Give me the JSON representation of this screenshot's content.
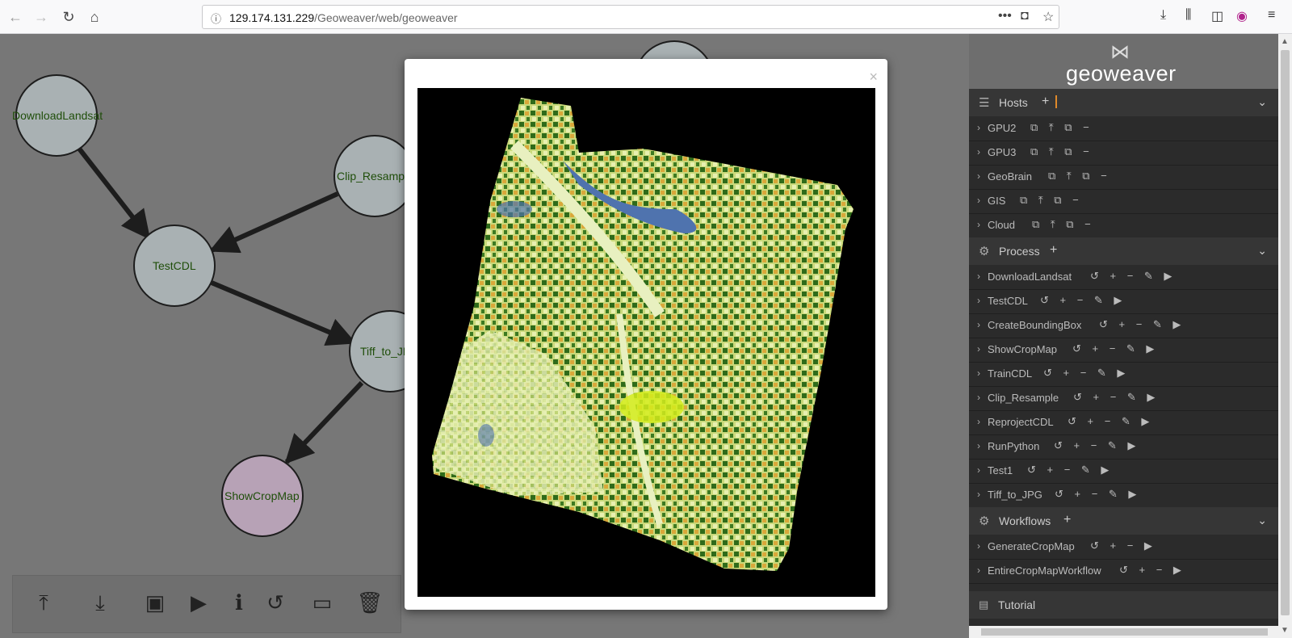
{
  "browser": {
    "url_domain": "129.174.131.229",
    "url_path": "/Geoweaver/web/geoweaver",
    "icons": {
      "back": "back-arrow-icon",
      "forward": "forward-arrow-icon",
      "reload": "reload-icon",
      "home": "home-icon",
      "info": "info-icon",
      "more": "more-icon",
      "pocket": "pocket-icon",
      "bookmark": "star-icon",
      "download": "download-icon",
      "library": "library-icon",
      "sidebar": "sidebar-icon",
      "extension": "extension-icon",
      "menu": "hamburger-menu-icon"
    }
  },
  "graph": {
    "nodes": [
      {
        "label": "DownloadLandsat"
      },
      {
        "label": "Clip_Resample"
      },
      {
        "label": "TestCDL"
      },
      {
        "label": "Tiff_to_JPG"
      },
      {
        "label": "ShowCropMap"
      }
    ]
  },
  "toolbar": {
    "buttons": [
      "upload",
      "download",
      "save",
      "play",
      "info",
      "history",
      "monitor",
      "delete"
    ]
  },
  "modal": {
    "close_label": "×",
    "image_alt": "Crop map image"
  },
  "sidebar": {
    "logo_text": "geoweaver",
    "hosts": {
      "title": "Hosts",
      "items": [
        "GPU2",
        "GPU3",
        "GeoBrain",
        "GIS",
        "Cloud"
      ]
    },
    "process": {
      "title": "Process",
      "items": [
        "DownloadLandsat",
        "TestCDL",
        "CreateBoundingBox",
        "ShowCropMap",
        "TrainCDL",
        "Clip_Resample",
        "ReprojectCDL",
        "RunPython",
        "Test1",
        "Tiff_to_JPG"
      ]
    },
    "workflows": {
      "title": "Workflows",
      "items": [
        "GenerateCropMap",
        "EntireCropMapWorkflow"
      ]
    },
    "tutorial": "Tutorial"
  },
  "colors": {
    "sidebar_bg": "#2b2b2b",
    "section_bg": "#363636",
    "node_fill": "#a9b1b3",
    "node_highlight": "#b7a2b6",
    "node_text": "#1f4e0a",
    "accent": "#e08a2a"
  }
}
